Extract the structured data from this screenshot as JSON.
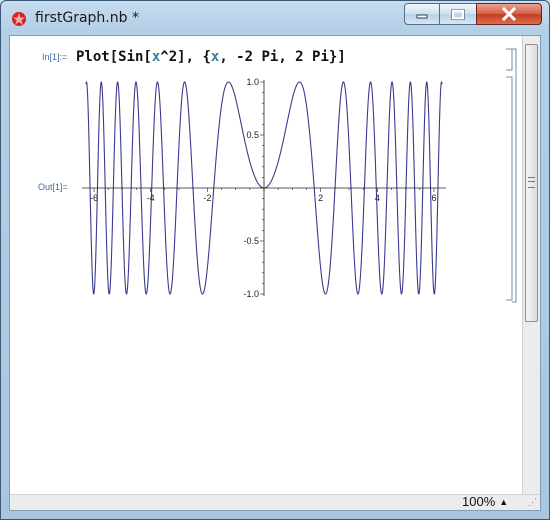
{
  "window": {
    "title": "firstGraph.nb *",
    "accent_close": "#c43c22"
  },
  "notebook": {
    "input_label": "In[1]:=",
    "input_code_parts": [
      "Plot[Sin[",
      "x",
      "^2], {",
      "x",
      ", -2 Pi, 2 Pi}]"
    ],
    "output_label": "Out[1]="
  },
  "chart_data": {
    "type": "line",
    "function": "Sin[x^2]",
    "xlim": [
      -6.283,
      6.283
    ],
    "ylim": [
      -1,
      1
    ],
    "x_ticks": [
      -6,
      -4,
      -2,
      2,
      4,
      6
    ],
    "y_ticks": [
      -1.0,
      -0.5,
      0.5,
      1.0
    ],
    "x_tick_labels": [
      "-6",
      "-4",
      "-2",
      "2",
      "4",
      "6"
    ],
    "y_tick_labels": [
      "-1.0",
      "-0.5",
      "0.5",
      "1.0"
    ],
    "line_color": "#3b3b8f",
    "grid": false
  },
  "statusbar": {
    "zoom": "100%"
  }
}
